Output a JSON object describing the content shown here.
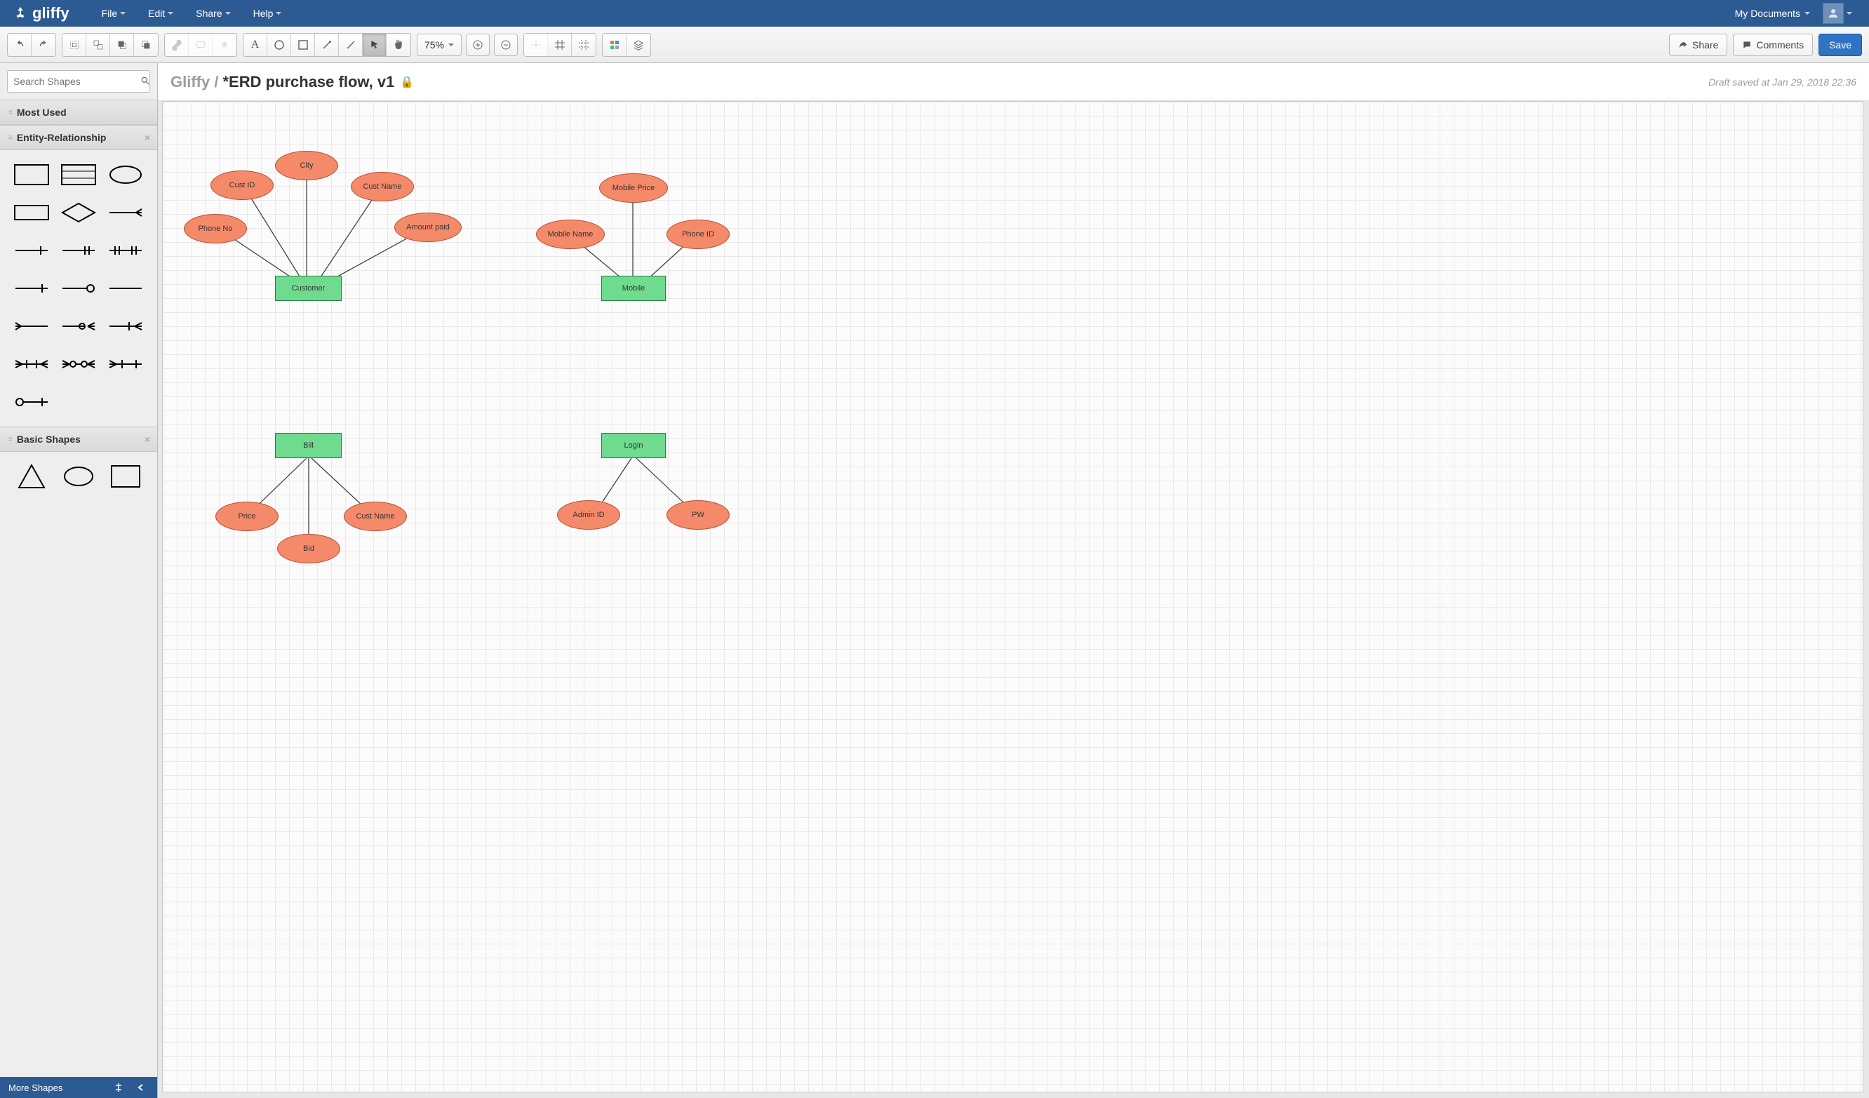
{
  "app": {
    "name": "gliffy"
  },
  "menu": {
    "items": [
      "File",
      "Edit",
      "Share",
      "Help"
    ],
    "my_docs": "My Documents"
  },
  "toolbar": {
    "zoom": "75%",
    "share": "Share",
    "comments": "Comments",
    "save": "Save"
  },
  "sidebar": {
    "search_placeholder": "Search Shapes",
    "sections": {
      "most_used": "Most Used",
      "er": "Entity-Relationship",
      "basic": "Basic Shapes"
    },
    "more_shapes": "More Shapes"
  },
  "doc": {
    "crumb": "Gliffy /",
    "title": "*ERD purchase flow, v1",
    "status": "Draft saved at Jan 29, 2018 22:36"
  },
  "erd": {
    "customer": {
      "entity": "Customer",
      "attrs": {
        "phone_no": "Phone No",
        "cust_id": "Cust ID",
        "city": "City",
        "cust_name": "Cust Name",
        "amount_paid": "Amount paid"
      }
    },
    "mobile": {
      "entity": "Mobile",
      "attrs": {
        "mobile_name": "Mobile Name",
        "mobile_price": "Mobile Price",
        "phone_id": "Phone ID"
      }
    },
    "bill": {
      "entity": "Bill",
      "attrs": {
        "price": "Price",
        "bid": "Bid",
        "cust_name": "Cust Name"
      }
    },
    "login": {
      "entity": "Login",
      "attrs": {
        "admin_id": "Admin ID",
        "pw": "PW"
      }
    }
  }
}
